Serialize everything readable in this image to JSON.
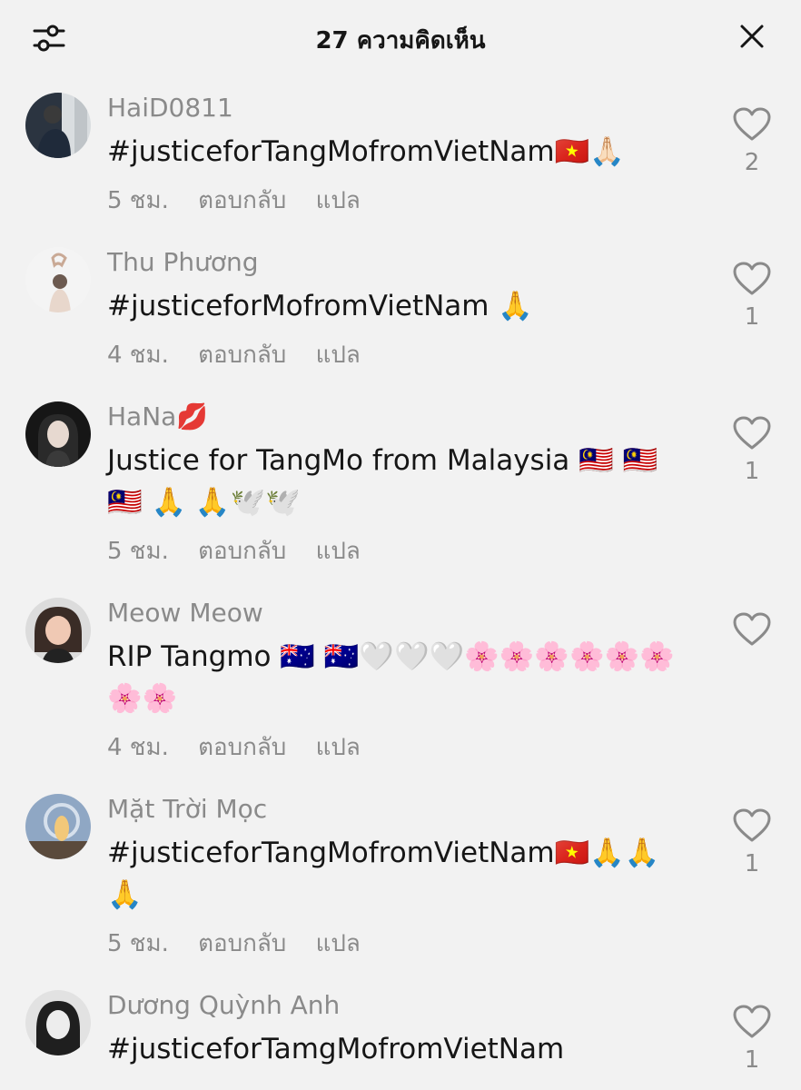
{
  "header": {
    "title": "27 ความคิดเห็น",
    "filter_icon": "sliders-icon",
    "close_icon": "close-icon"
  },
  "comments": [
    {
      "username": "HaiD0811",
      "text": "#justiceforTangMofromVietNam🇻🇳🙏🏻",
      "time": "5 ชม.",
      "reply": "ตอบกลับ",
      "translate": "แปล",
      "likes": "2"
    },
    {
      "username": "Thu Phương",
      "text": "#justiceforMofromVietNam 🙏",
      "time": "4 ชม.",
      "reply": "ตอบกลับ",
      "translate": "แปล",
      "likes": "1"
    },
    {
      "username": "HaNa💋",
      "text": "Justice for TangMo from Malaysia 🇲🇾 🇲🇾 🇲🇾 🙏 🙏🕊️🕊️",
      "time": "5 ชม.",
      "reply": "ตอบกลับ",
      "translate": "แปล",
      "likes": "1"
    },
    {
      "username": "Meow Meow",
      "text": "RIP Tangmo 🇦🇺 🇦🇺🤍🤍🤍🌸🌸🌸🌸🌸🌸🌸🌸",
      "time": "4 ชม.",
      "reply": "ตอบกลับ",
      "translate": "แปล",
      "likes": ""
    },
    {
      "username": "Mặt Trời Mọc",
      "text": "#justiceforTangMofromVietNam🇻🇳🙏🙏🙏",
      "time": "5 ชม.",
      "reply": "ตอบกลับ",
      "translate": "แปล",
      "likes": "1"
    },
    {
      "username": "Dương Quỳnh Anh",
      "text": "#justiceforTamgMofromVietNam",
      "time": "",
      "reply": "",
      "translate": "",
      "likes": "1"
    }
  ],
  "colors": {
    "background": "#f2f2f2",
    "text": "#161616",
    "muted": "#8a8a8a"
  }
}
